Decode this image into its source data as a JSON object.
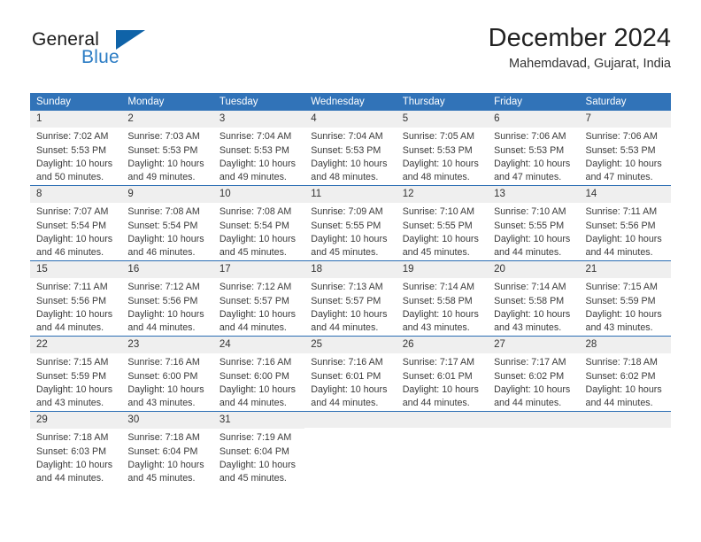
{
  "brand": {
    "name_part1": "General",
    "name_part2": "Blue",
    "logo_icon": "triangle-flag-icon",
    "accent_color": "#0f63a8",
    "blue_text_color": "#2b7cc4"
  },
  "header": {
    "title": "December 2024",
    "subtitle": "Mahemdavad, Gujarat, India"
  },
  "theme": {
    "header_bar_color": "#3173b8",
    "row_divider_color": "#2a6db3",
    "daynum_strip_color": "#efefef",
    "text_color": "#3a3a3a"
  },
  "weekdays": [
    "Sunday",
    "Monday",
    "Tuesday",
    "Wednesday",
    "Thursday",
    "Friday",
    "Saturday"
  ],
  "weeks": [
    [
      {
        "day": "1",
        "sunrise": "Sunrise: 7:02 AM",
        "sunset": "Sunset: 5:53 PM",
        "daylight_line1": "Daylight: 10 hours",
        "daylight_line2": "and 50 minutes."
      },
      {
        "day": "2",
        "sunrise": "Sunrise: 7:03 AM",
        "sunset": "Sunset: 5:53 PM",
        "daylight_line1": "Daylight: 10 hours",
        "daylight_line2": "and 49 minutes."
      },
      {
        "day": "3",
        "sunrise": "Sunrise: 7:04 AM",
        "sunset": "Sunset: 5:53 PM",
        "daylight_line1": "Daylight: 10 hours",
        "daylight_line2": "and 49 minutes."
      },
      {
        "day": "4",
        "sunrise": "Sunrise: 7:04 AM",
        "sunset": "Sunset: 5:53 PM",
        "daylight_line1": "Daylight: 10 hours",
        "daylight_line2": "and 48 minutes."
      },
      {
        "day": "5",
        "sunrise": "Sunrise: 7:05 AM",
        "sunset": "Sunset: 5:53 PM",
        "daylight_line1": "Daylight: 10 hours",
        "daylight_line2": "and 48 minutes."
      },
      {
        "day": "6",
        "sunrise": "Sunrise: 7:06 AM",
        "sunset": "Sunset: 5:53 PM",
        "daylight_line1": "Daylight: 10 hours",
        "daylight_line2": "and 47 minutes."
      },
      {
        "day": "7",
        "sunrise": "Sunrise: 7:06 AM",
        "sunset": "Sunset: 5:53 PM",
        "daylight_line1": "Daylight: 10 hours",
        "daylight_line2": "and 47 minutes."
      }
    ],
    [
      {
        "day": "8",
        "sunrise": "Sunrise: 7:07 AM",
        "sunset": "Sunset: 5:54 PM",
        "daylight_line1": "Daylight: 10 hours",
        "daylight_line2": "and 46 minutes."
      },
      {
        "day": "9",
        "sunrise": "Sunrise: 7:08 AM",
        "sunset": "Sunset: 5:54 PM",
        "daylight_line1": "Daylight: 10 hours",
        "daylight_line2": "and 46 minutes."
      },
      {
        "day": "10",
        "sunrise": "Sunrise: 7:08 AM",
        "sunset": "Sunset: 5:54 PM",
        "daylight_line1": "Daylight: 10 hours",
        "daylight_line2": "and 45 minutes."
      },
      {
        "day": "11",
        "sunrise": "Sunrise: 7:09 AM",
        "sunset": "Sunset: 5:55 PM",
        "daylight_line1": "Daylight: 10 hours",
        "daylight_line2": "and 45 minutes."
      },
      {
        "day": "12",
        "sunrise": "Sunrise: 7:10 AM",
        "sunset": "Sunset: 5:55 PM",
        "daylight_line1": "Daylight: 10 hours",
        "daylight_line2": "and 45 minutes."
      },
      {
        "day": "13",
        "sunrise": "Sunrise: 7:10 AM",
        "sunset": "Sunset: 5:55 PM",
        "daylight_line1": "Daylight: 10 hours",
        "daylight_line2": "and 44 minutes."
      },
      {
        "day": "14",
        "sunrise": "Sunrise: 7:11 AM",
        "sunset": "Sunset: 5:56 PM",
        "daylight_line1": "Daylight: 10 hours",
        "daylight_line2": "and 44 minutes."
      }
    ],
    [
      {
        "day": "15",
        "sunrise": "Sunrise: 7:11 AM",
        "sunset": "Sunset: 5:56 PM",
        "daylight_line1": "Daylight: 10 hours",
        "daylight_line2": "and 44 minutes."
      },
      {
        "day": "16",
        "sunrise": "Sunrise: 7:12 AM",
        "sunset": "Sunset: 5:56 PM",
        "daylight_line1": "Daylight: 10 hours",
        "daylight_line2": "and 44 minutes."
      },
      {
        "day": "17",
        "sunrise": "Sunrise: 7:12 AM",
        "sunset": "Sunset: 5:57 PM",
        "daylight_line1": "Daylight: 10 hours",
        "daylight_line2": "and 44 minutes."
      },
      {
        "day": "18",
        "sunrise": "Sunrise: 7:13 AM",
        "sunset": "Sunset: 5:57 PM",
        "daylight_line1": "Daylight: 10 hours",
        "daylight_line2": "and 44 minutes."
      },
      {
        "day": "19",
        "sunrise": "Sunrise: 7:14 AM",
        "sunset": "Sunset: 5:58 PM",
        "daylight_line1": "Daylight: 10 hours",
        "daylight_line2": "and 43 minutes."
      },
      {
        "day": "20",
        "sunrise": "Sunrise: 7:14 AM",
        "sunset": "Sunset: 5:58 PM",
        "daylight_line1": "Daylight: 10 hours",
        "daylight_line2": "and 43 minutes."
      },
      {
        "day": "21",
        "sunrise": "Sunrise: 7:15 AM",
        "sunset": "Sunset: 5:59 PM",
        "daylight_line1": "Daylight: 10 hours",
        "daylight_line2": "and 43 minutes."
      }
    ],
    [
      {
        "day": "22",
        "sunrise": "Sunrise: 7:15 AM",
        "sunset": "Sunset: 5:59 PM",
        "daylight_line1": "Daylight: 10 hours",
        "daylight_line2": "and 43 minutes."
      },
      {
        "day": "23",
        "sunrise": "Sunrise: 7:16 AM",
        "sunset": "Sunset: 6:00 PM",
        "daylight_line1": "Daylight: 10 hours",
        "daylight_line2": "and 43 minutes."
      },
      {
        "day": "24",
        "sunrise": "Sunrise: 7:16 AM",
        "sunset": "Sunset: 6:00 PM",
        "daylight_line1": "Daylight: 10 hours",
        "daylight_line2": "and 44 minutes."
      },
      {
        "day": "25",
        "sunrise": "Sunrise: 7:16 AM",
        "sunset": "Sunset: 6:01 PM",
        "daylight_line1": "Daylight: 10 hours",
        "daylight_line2": "and 44 minutes."
      },
      {
        "day": "26",
        "sunrise": "Sunrise: 7:17 AM",
        "sunset": "Sunset: 6:01 PM",
        "daylight_line1": "Daylight: 10 hours",
        "daylight_line2": "and 44 minutes."
      },
      {
        "day": "27",
        "sunrise": "Sunrise: 7:17 AM",
        "sunset": "Sunset: 6:02 PM",
        "daylight_line1": "Daylight: 10 hours",
        "daylight_line2": "and 44 minutes."
      },
      {
        "day": "28",
        "sunrise": "Sunrise: 7:18 AM",
        "sunset": "Sunset: 6:02 PM",
        "daylight_line1": "Daylight: 10 hours",
        "daylight_line2": "and 44 minutes."
      }
    ],
    [
      {
        "day": "29",
        "sunrise": "Sunrise: 7:18 AM",
        "sunset": "Sunset: 6:03 PM",
        "daylight_line1": "Daylight: 10 hours",
        "daylight_line2": "and 44 minutes."
      },
      {
        "day": "30",
        "sunrise": "Sunrise: 7:18 AM",
        "sunset": "Sunset: 6:04 PM",
        "daylight_line1": "Daylight: 10 hours",
        "daylight_line2": "and 45 minutes."
      },
      {
        "day": "31",
        "sunrise": "Sunrise: 7:19 AM",
        "sunset": "Sunset: 6:04 PM",
        "daylight_line1": "Daylight: 10 hours",
        "daylight_line2": "and 45 minutes."
      },
      {
        "day": "",
        "sunrise": "",
        "sunset": "",
        "daylight_line1": "",
        "daylight_line2": ""
      },
      {
        "day": "",
        "sunrise": "",
        "sunset": "",
        "daylight_line1": "",
        "daylight_line2": ""
      },
      {
        "day": "",
        "sunrise": "",
        "sunset": "",
        "daylight_line1": "",
        "daylight_line2": ""
      },
      {
        "day": "",
        "sunrise": "",
        "sunset": "",
        "daylight_line1": "",
        "daylight_line2": ""
      }
    ]
  ]
}
